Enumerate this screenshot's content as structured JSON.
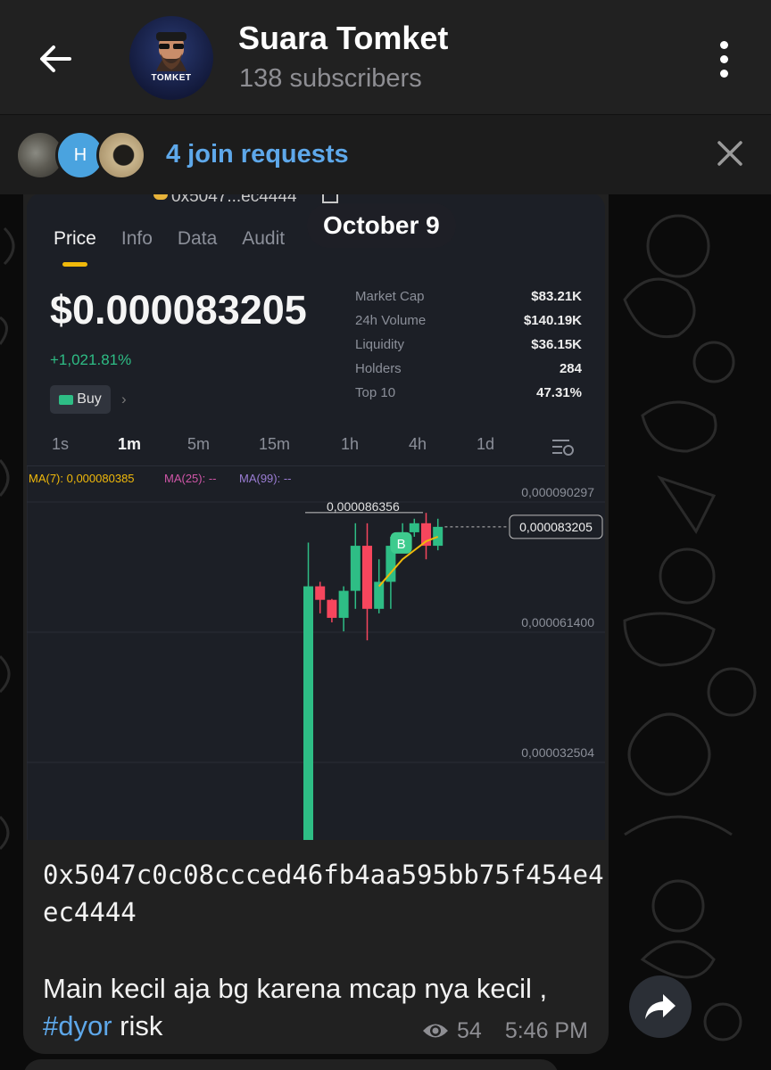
{
  "header": {
    "title": "Suara Tomket",
    "subtitle": "138 subscribers",
    "avatar_label": "TOMKET"
  },
  "join_bar": {
    "avatar2_letter": "H",
    "label": "4 join requests"
  },
  "post": {
    "date_pill": "October 9",
    "screenshot": {
      "contract_short": "0x5047...ec4444",
      "tabs": [
        "Price",
        "Info",
        "Data",
        "Audit"
      ],
      "active_tab": "Price",
      "price": "$0.000083205",
      "change": "+1,021.81%",
      "buy_label": "Buy",
      "stats": [
        {
          "label": "Market Cap",
          "value": "$83.21K"
        },
        {
          "label": "24h Volume",
          "value": "$140.19K"
        },
        {
          "label": "Liquidity",
          "value": "$36.15K"
        },
        {
          "label": "Holders",
          "value": "284"
        },
        {
          "label": "Top 10",
          "value": "47.31%"
        }
      ],
      "intervals": [
        "1s",
        "1m",
        "5m",
        "15m",
        "1h",
        "4h",
        "1d"
      ],
      "active_interval": "1m",
      "ma7": "MA(7): 0,000080385",
      "ma25": "MA(25): --",
      "ma99": "MA(99): --",
      "y_ticks": [
        "0,000090297",
        "0,000061400",
        "0,000032504"
      ],
      "last_price_tag": "0,000083205",
      "high_label": "0,000086356",
      "marker_label": "B"
    },
    "contract": "0x5047c0c08ccced46fb4aa595bb75f454e4ec4444",
    "text_before_tag": "Main kecil aja bg karena mcap nya kecil , ",
    "hashtag": "#dyor",
    "text_after_tag": " risk",
    "views": "54",
    "time": "5:46 PM"
  },
  "colors": {
    "accent": "#5ea8ea",
    "up": "#2ebd85",
    "down": "#f6465d",
    "ma7": "#f0b90b",
    "ma25": "#d056a8",
    "ma99": "#9b7dd4"
  },
  "chart_data": {
    "type": "candlestick",
    "y_axis_ticks": [
      9.0297e-05,
      6.14e-05,
      3.2504e-05
    ],
    "last_price": 8.3205e-05,
    "high_marker": 8.6356e-05,
    "candles": [
      {
        "o": 4e-06,
        "h": 7.97e-05,
        "l": 4e-06,
        "c": 7e-05
      },
      {
        "o": 7e-05,
        "h": 7.1e-05,
        "l": 6.4e-05,
        "c": 6.7e-05
      },
      {
        "o": 6.7e-05,
        "h": 6.72e-05,
        "l": 6.2e-05,
        "c": 6.3e-05
      },
      {
        "o": 6.3e-05,
        "h": 7e-05,
        "l": 6e-05,
        "c": 6.9e-05
      },
      {
        "o": 6.9e-05,
        "h": 8.4e-05,
        "l": 6.5e-05,
        "c": 7.9e-05
      },
      {
        "o": 7.9e-05,
        "h": 8.4e-05,
        "l": 5.8e-05,
        "c": 6.5e-05
      },
      {
        "o": 6.5e-05,
        "h": 7.6e-05,
        "l": 6.4e-05,
        "c": 7.1e-05
      },
      {
        "o": 7.1e-05,
        "h": 8.1e-05,
        "l": 6.5e-05,
        "c": 7.9e-05
      },
      {
        "o": 7.9e-05,
        "h": 8.4e-05,
        "l": 7.8e-05,
        "c": 8.2e-05
      },
      {
        "o": 8.2e-05,
        "h": 8.5e-05,
        "l": 8.1e-05,
        "c": 8.4e-05
      },
      {
        "o": 8.4e-05,
        "h": 8.63e-05,
        "l": 7.6e-05,
        "c": 7.9e-05
      },
      {
        "o": 7.9e-05,
        "h": 8.5e-05,
        "l": 7.8e-05,
        "c": 8.32e-05
      }
    ],
    "ma7_points": [
      7e-05,
      7.3e-05,
      7.6e-05,
      7.8e-05,
      8e-05,
      8.1e-05
    ]
  }
}
